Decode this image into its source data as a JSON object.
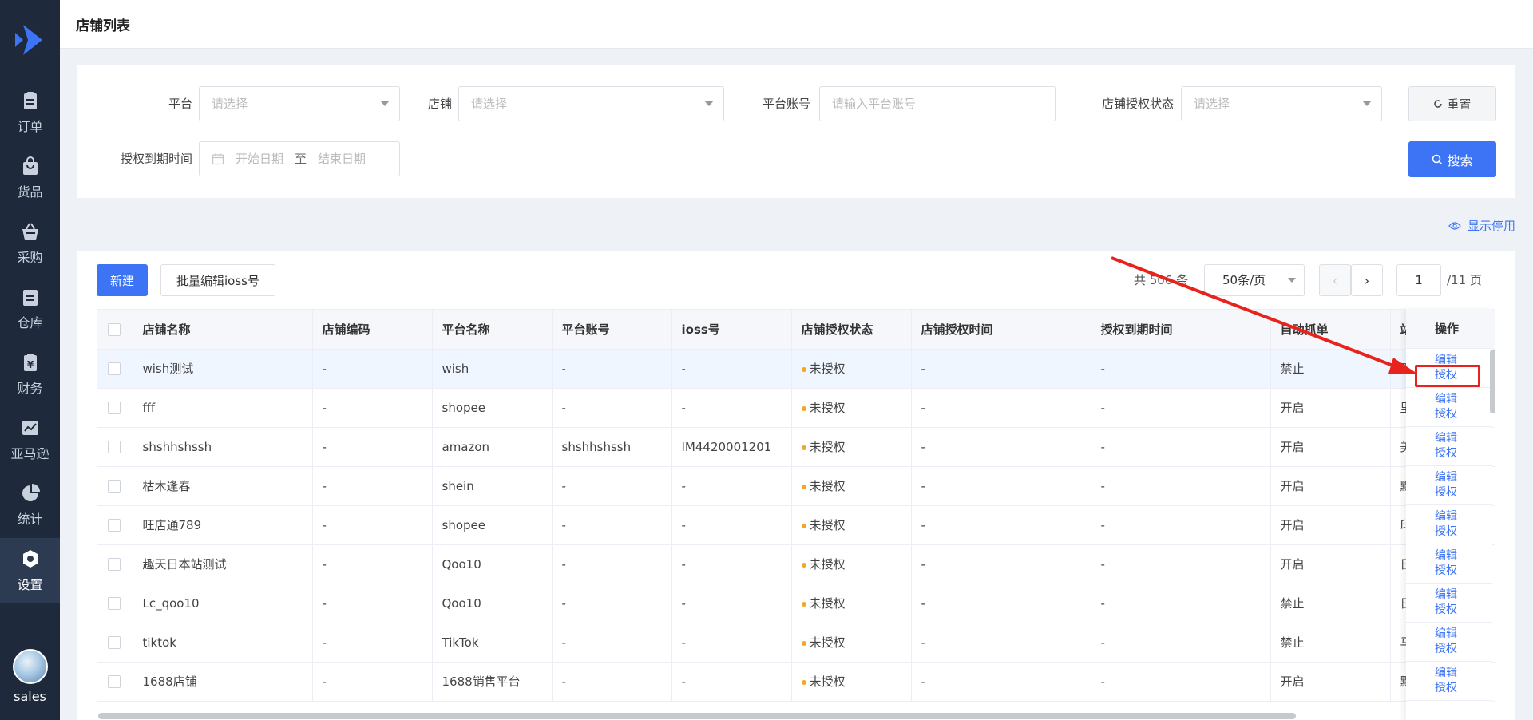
{
  "sidebar": {
    "items": [
      {
        "label": "订单",
        "icon": "clipboard-icon",
        "active": false
      },
      {
        "label": "货品",
        "icon": "shopping-bag-icon",
        "active": false
      },
      {
        "label": "采购",
        "icon": "basket-icon",
        "active": false
      },
      {
        "label": "仓库",
        "icon": "warehouse-icon",
        "active": false
      },
      {
        "label": "财务",
        "icon": "yen-icon",
        "active": false
      },
      {
        "label": "亚马逊",
        "icon": "chart-line-icon",
        "active": false
      },
      {
        "label": "统计",
        "icon": "pie-chart-icon",
        "active": false
      },
      {
        "label": "设置",
        "icon": "gear-icon",
        "active": true
      }
    ],
    "user": "sales"
  },
  "header": {
    "title": "店铺列表"
  },
  "filters": {
    "platform_label": "平台",
    "platform_placeholder": "请选择",
    "shop_label": "店铺",
    "shop_placeholder": "请选择",
    "account_label": "平台账号",
    "account_placeholder": "请输入平台账号",
    "auth_status_label": "店铺授权状态",
    "auth_status_placeholder": "请选择",
    "expire_label": "授权到期时间",
    "start_date": "开始日期",
    "to": "至",
    "end_date": "结束日期",
    "reset_label": "重置",
    "search_label": "搜索"
  },
  "show_disabled": "显示停用",
  "toolbar": {
    "new_label": "新建",
    "batch_ioss_label": "批量编辑ioss号"
  },
  "pager": {
    "total": "共 506 条",
    "size": "50条/页",
    "page": "1",
    "pages": "/11 页"
  },
  "table": {
    "headers": [
      "店铺名称",
      "店铺编码",
      "平台名称",
      "平台账号",
      "ioss号",
      "店铺授权状态",
      "店铺授权时间",
      "授权到期时间",
      "自动抓单",
      "站"
    ],
    "ops_header": "操作",
    "edit_label": "编辑",
    "auth_label": "授权",
    "rows": [
      {
        "name": "wish测试",
        "code": "-",
        "platform": "wish",
        "account": "-",
        "ioss": "-",
        "status": "未授权",
        "auth_time": "-",
        "expire": "-",
        "auto": "禁止",
        "site": "默"
      },
      {
        "name": "fff",
        "code": "-",
        "platform": "shopee",
        "account": "-",
        "ioss": "-",
        "status": "未授权",
        "auth_time": "-",
        "expire": "-",
        "auto": "开启",
        "site": "里"
      },
      {
        "name": "shshhshssh",
        "code": "-",
        "platform": "amazon",
        "account": "shshhshssh",
        "ioss": "IM4420001201",
        "status": "未授权",
        "auth_time": "-",
        "expire": "-",
        "auto": "开启",
        "site": "美"
      },
      {
        "name": "枯木逢春",
        "code": "-",
        "platform": "shein",
        "account": "-",
        "ioss": "-",
        "status": "未授权",
        "auth_time": "-",
        "expire": "-",
        "auto": "开启",
        "site": "默"
      },
      {
        "name": "旺店通789",
        "code": "-",
        "platform": "shopee",
        "account": "-",
        "ioss": "-",
        "status": "未授权",
        "auth_time": "-",
        "expire": "-",
        "auto": "开启",
        "site": "印"
      },
      {
        "name": "趣天日本站测试",
        "code": "-",
        "platform": "Qoo10",
        "account": "-",
        "ioss": "-",
        "status": "未授权",
        "auth_time": "-",
        "expire": "-",
        "auto": "开启",
        "site": "日"
      },
      {
        "name": "Lc_qoo10",
        "code": "-",
        "platform": "Qoo10",
        "account": "-",
        "ioss": "-",
        "status": "未授权",
        "auth_time": "-",
        "expire": "-",
        "auto": "禁止",
        "site": "日"
      },
      {
        "name": "tiktok",
        "code": "-",
        "platform": "TikTok",
        "account": "-",
        "ioss": "-",
        "status": "未授权",
        "auth_time": "-",
        "expire": "-",
        "auto": "禁止",
        "site": "马"
      },
      {
        "name": "1688店铺",
        "code": "-",
        "platform": "1688销售平台",
        "account": "-",
        "ioss": "-",
        "status": "未授权",
        "auth_time": "-",
        "expire": "-",
        "auto": "开启",
        "site": "默"
      }
    ]
  }
}
